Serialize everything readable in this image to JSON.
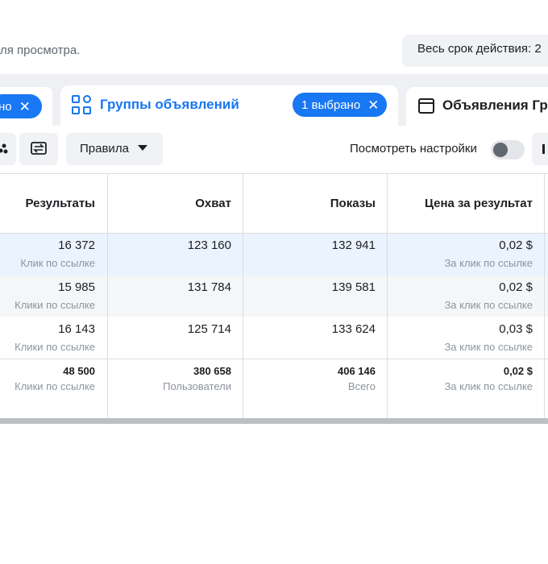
{
  "header": {
    "hint_text": "ля просмотра.",
    "date_range_label": "Весь срок действия: 2"
  },
  "tabs": [
    {
      "label": "",
      "chip_label": "но"
    },
    {
      "label": "Группы объявлений",
      "chip_label": "1 выбрано",
      "active": true
    },
    {
      "label": "Объявления Гр",
      "active": false
    }
  ],
  "toolbar": {
    "rules_label": "Правила",
    "view_settings_label": "Посмотреть настройки",
    "view_settings_on": false
  },
  "table": {
    "columns": [
      "Результаты",
      "Охват",
      "Показы",
      "Цена за результат"
    ],
    "rows": [
      {
        "results": "16 372",
        "results_sub": "Клик по ссылке",
        "reach": "123 160",
        "impressions": "132 941",
        "cost": "0,02 $",
        "cost_sub": "За клик по ссылке"
      },
      {
        "results": "15 985",
        "results_sub": "Клики по ссылке",
        "reach": "131 784",
        "impressions": "139 581",
        "cost": "0,02 $",
        "cost_sub": "За клик по ссылке"
      },
      {
        "results": "16 143",
        "results_sub": "Клики по ссылке",
        "reach": "125 714",
        "impressions": "133 624",
        "cost": "0,03 $",
        "cost_sub": "За клик по ссылке"
      }
    ],
    "totals": {
      "results": "48 500",
      "results_sub": "Клики по ссылке",
      "reach": "380 658",
      "reach_sub": "Пользователи",
      "impressions": "406 146",
      "impressions_sub": "Всего",
      "cost": "0,02 $",
      "cost_sub": "За клик по ссылке"
    }
  },
  "colors": {
    "accent": "#1877f2",
    "highlight_row": "#ebf3fe"
  }
}
